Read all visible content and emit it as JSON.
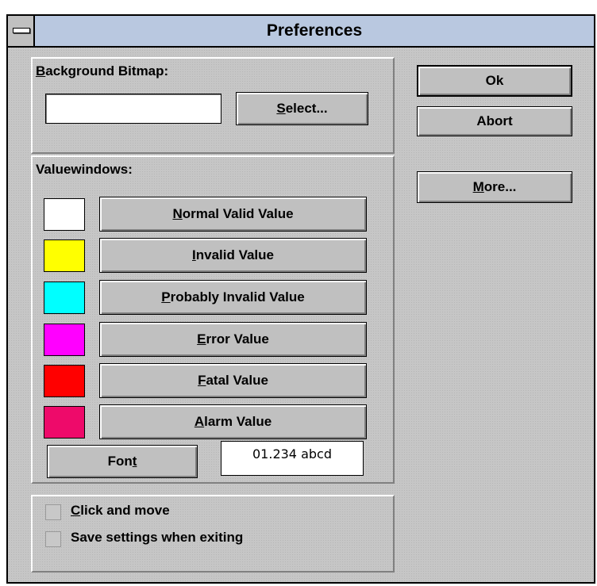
{
  "window": {
    "title": "Preferences"
  },
  "background_bitmap": {
    "label": "Background Bitmap:",
    "value": "",
    "select_button": "Select..."
  },
  "actions": {
    "ok": "Ok",
    "abort": "Abort",
    "more": "More..."
  },
  "valuewindows": {
    "label": "Valuewindows:",
    "items": [
      {
        "label": "Normal Valid Value",
        "color": "#ffffff"
      },
      {
        "label": "Invalid Value",
        "color": "#ffff00"
      },
      {
        "label": "Probably Invalid Value",
        "color": "#00ffff"
      },
      {
        "label": "Error Value",
        "color": "#ff00ff"
      },
      {
        "label": "Fatal Value",
        "color": "#ff0000"
      },
      {
        "label": "Alarm Value",
        "color": "#ee0a6a"
      }
    ],
    "font_button": "Font",
    "font_sample": "01.234 abcd"
  },
  "options": {
    "click_and_move": {
      "label": "Click and move",
      "checked": false
    },
    "save_settings": {
      "label": "Save settings when exiting",
      "checked": false
    }
  }
}
